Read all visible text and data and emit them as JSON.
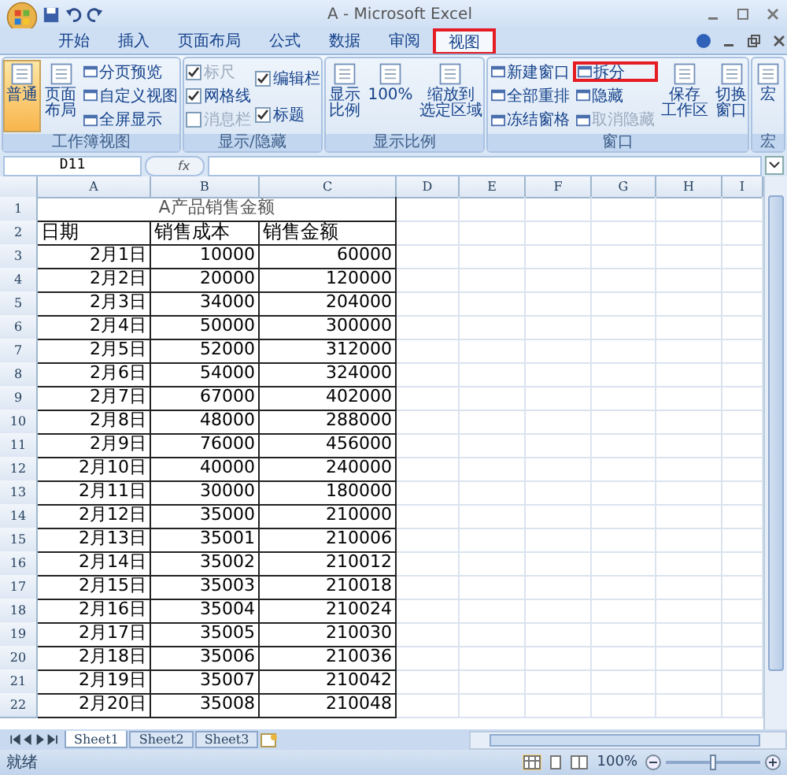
{
  "window": {
    "title": "A - Microsoft Excel"
  },
  "tabs": [
    {
      "label": "开始",
      "selected": false,
      "highlighted": false
    },
    {
      "label": "插入",
      "selected": false,
      "highlighted": false
    },
    {
      "label": "页面布局",
      "selected": false,
      "highlighted": false
    },
    {
      "label": "公式",
      "selected": false,
      "highlighted": false
    },
    {
      "label": "数据",
      "selected": false,
      "highlighted": false
    },
    {
      "label": "审阅",
      "selected": false,
      "highlighted": false
    },
    {
      "label": "视图",
      "selected": true,
      "highlighted": true
    }
  ],
  "ribbon_groups": [
    {
      "label": "工作簿视图",
      "items": [
        {
          "kind": "large",
          "lines": [
            "普通"
          ],
          "selected": true,
          "highlighted": false,
          "disabled": false
        },
        {
          "kind": "large",
          "lines": [
            "页面布局"
          ],
          "selected": false,
          "highlighted": false,
          "disabled": false
        },
        {
          "kind": "small",
          "label": "分页预览",
          "highlighted": false,
          "disabled": false
        },
        {
          "kind": "small",
          "label": "自定义视图",
          "highlighted": false,
          "disabled": false
        },
        {
          "kind": "small",
          "label": "全屏显示",
          "highlighted": false,
          "disabled": false
        }
      ]
    },
    {
      "label": "显示/隐藏",
      "items": [
        {
          "kind": "check",
          "label": "标尺",
          "checked": true,
          "disabled": true
        },
        {
          "kind": "check",
          "label": "网格线",
          "checked": true,
          "disabled": false
        },
        {
          "kind": "check",
          "label": "消息栏",
          "checked": false,
          "disabled": true
        },
        {
          "kind": "check",
          "label": "编辑栏",
          "checked": true,
          "disabled": false
        },
        {
          "kind": "check",
          "label": "标题",
          "checked": true,
          "disabled": false
        }
      ]
    },
    {
      "label": "显示比例",
      "items": [
        {
          "kind": "large",
          "lines": [
            "显示比例"
          ],
          "selected": false,
          "highlighted": false,
          "disabled": false
        },
        {
          "kind": "large",
          "lines": [
            "100%"
          ],
          "selected": false,
          "highlighted": false,
          "disabled": false
        },
        {
          "kind": "large",
          "lines": [
            "缩放到",
            "选定区域"
          ],
          "selected": false,
          "highlighted": false,
          "disabled": false
        }
      ]
    },
    {
      "label": "窗口",
      "items": [
        {
          "kind": "small",
          "label": "新建窗口",
          "highlighted": false,
          "disabled": false
        },
        {
          "kind": "small",
          "label": "全部重排",
          "highlighted": false,
          "disabled": false
        },
        {
          "kind": "small",
          "label": "冻结窗格",
          "highlighted": false,
          "disabled": false
        },
        {
          "kind": "small",
          "label": "拆分",
          "highlighted": true,
          "disabled": false
        },
        {
          "kind": "small",
          "label": "隐藏",
          "highlighted": false,
          "disabled": false
        },
        {
          "kind": "small",
          "label": "取消隐藏",
          "highlighted": false,
          "disabled": true
        },
        {
          "kind": "large",
          "lines": [
            "保存",
            "工作区"
          ],
          "selected": false,
          "highlighted": false,
          "disabled": false
        },
        {
          "kind": "large",
          "lines": [
            "切换窗口"
          ],
          "selected": false,
          "highlighted": false,
          "disabled": false
        }
      ]
    },
    {
      "label": "宏",
      "items": [
        {
          "kind": "large",
          "lines": [
            "宏"
          ],
          "selected": false,
          "highlighted": false,
          "disabled": false
        }
      ]
    }
  ],
  "formula_bar": {
    "name_box": "D11",
    "fx": "fx"
  },
  "columns": [
    "A",
    "B",
    "C",
    "D",
    "E",
    "F",
    "G",
    "H",
    "I"
  ],
  "sheet": {
    "title_row": "1",
    "title": "A产品销售金额",
    "header_row": "2",
    "headers": [
      "日期",
      "销售成本",
      "销售金额"
    ],
    "rows": [
      {
        "row": "3",
        "cells": [
          "2月1日",
          "10000",
          "60000"
        ]
      },
      {
        "row": "4",
        "cells": [
          "2月2日",
          "20000",
          "120000"
        ]
      },
      {
        "row": "5",
        "cells": [
          "2月3日",
          "34000",
          "204000"
        ]
      },
      {
        "row": "6",
        "cells": [
          "2月4日",
          "50000",
          "300000"
        ]
      },
      {
        "row": "7",
        "cells": [
          "2月5日",
          "52000",
          "312000"
        ]
      },
      {
        "row": "8",
        "cells": [
          "2月6日",
          "54000",
          "324000"
        ]
      },
      {
        "row": "9",
        "cells": [
          "2月7日",
          "67000",
          "402000"
        ]
      },
      {
        "row": "10",
        "cells": [
          "2月8日",
          "48000",
          "288000"
        ]
      },
      {
        "row": "11",
        "cells": [
          "2月9日",
          "76000",
          "456000"
        ]
      },
      {
        "row": "12",
        "cells": [
          "2月10日",
          "40000",
          "240000"
        ]
      },
      {
        "row": "13",
        "cells": [
          "2月11日",
          "30000",
          "180000"
        ]
      },
      {
        "row": "14",
        "cells": [
          "2月12日",
          "35000",
          "210000"
        ]
      },
      {
        "row": "15",
        "cells": [
          "2月13日",
          "35001",
          "210006"
        ]
      },
      {
        "row": "16",
        "cells": [
          "2月14日",
          "35002",
          "210012"
        ]
      },
      {
        "row": "17",
        "cells": [
          "2月15日",
          "35003",
          "210018"
        ]
      },
      {
        "row": "18",
        "cells": [
          "2月16日",
          "35004",
          "210024"
        ]
      },
      {
        "row": "19",
        "cells": [
          "2月17日",
          "35005",
          "210030"
        ]
      },
      {
        "row": "20",
        "cells": [
          "2月18日",
          "35006",
          "210036"
        ]
      },
      {
        "row": "21",
        "cells": [
          "2月19日",
          "35007",
          "210042"
        ]
      },
      {
        "row": "22",
        "cells": [
          "2月20日",
          "35008",
          "210048"
        ]
      }
    ]
  },
  "sheet_tabs": [
    {
      "label": "Sheet1",
      "selected": true
    },
    {
      "label": "Sheet2",
      "selected": false
    },
    {
      "label": "Sheet3",
      "selected": false
    }
  ],
  "status_bar": {
    "status": "就绪",
    "zoom": "100%",
    "zoom_level": {
      "level": 0.5
    }
  }
}
